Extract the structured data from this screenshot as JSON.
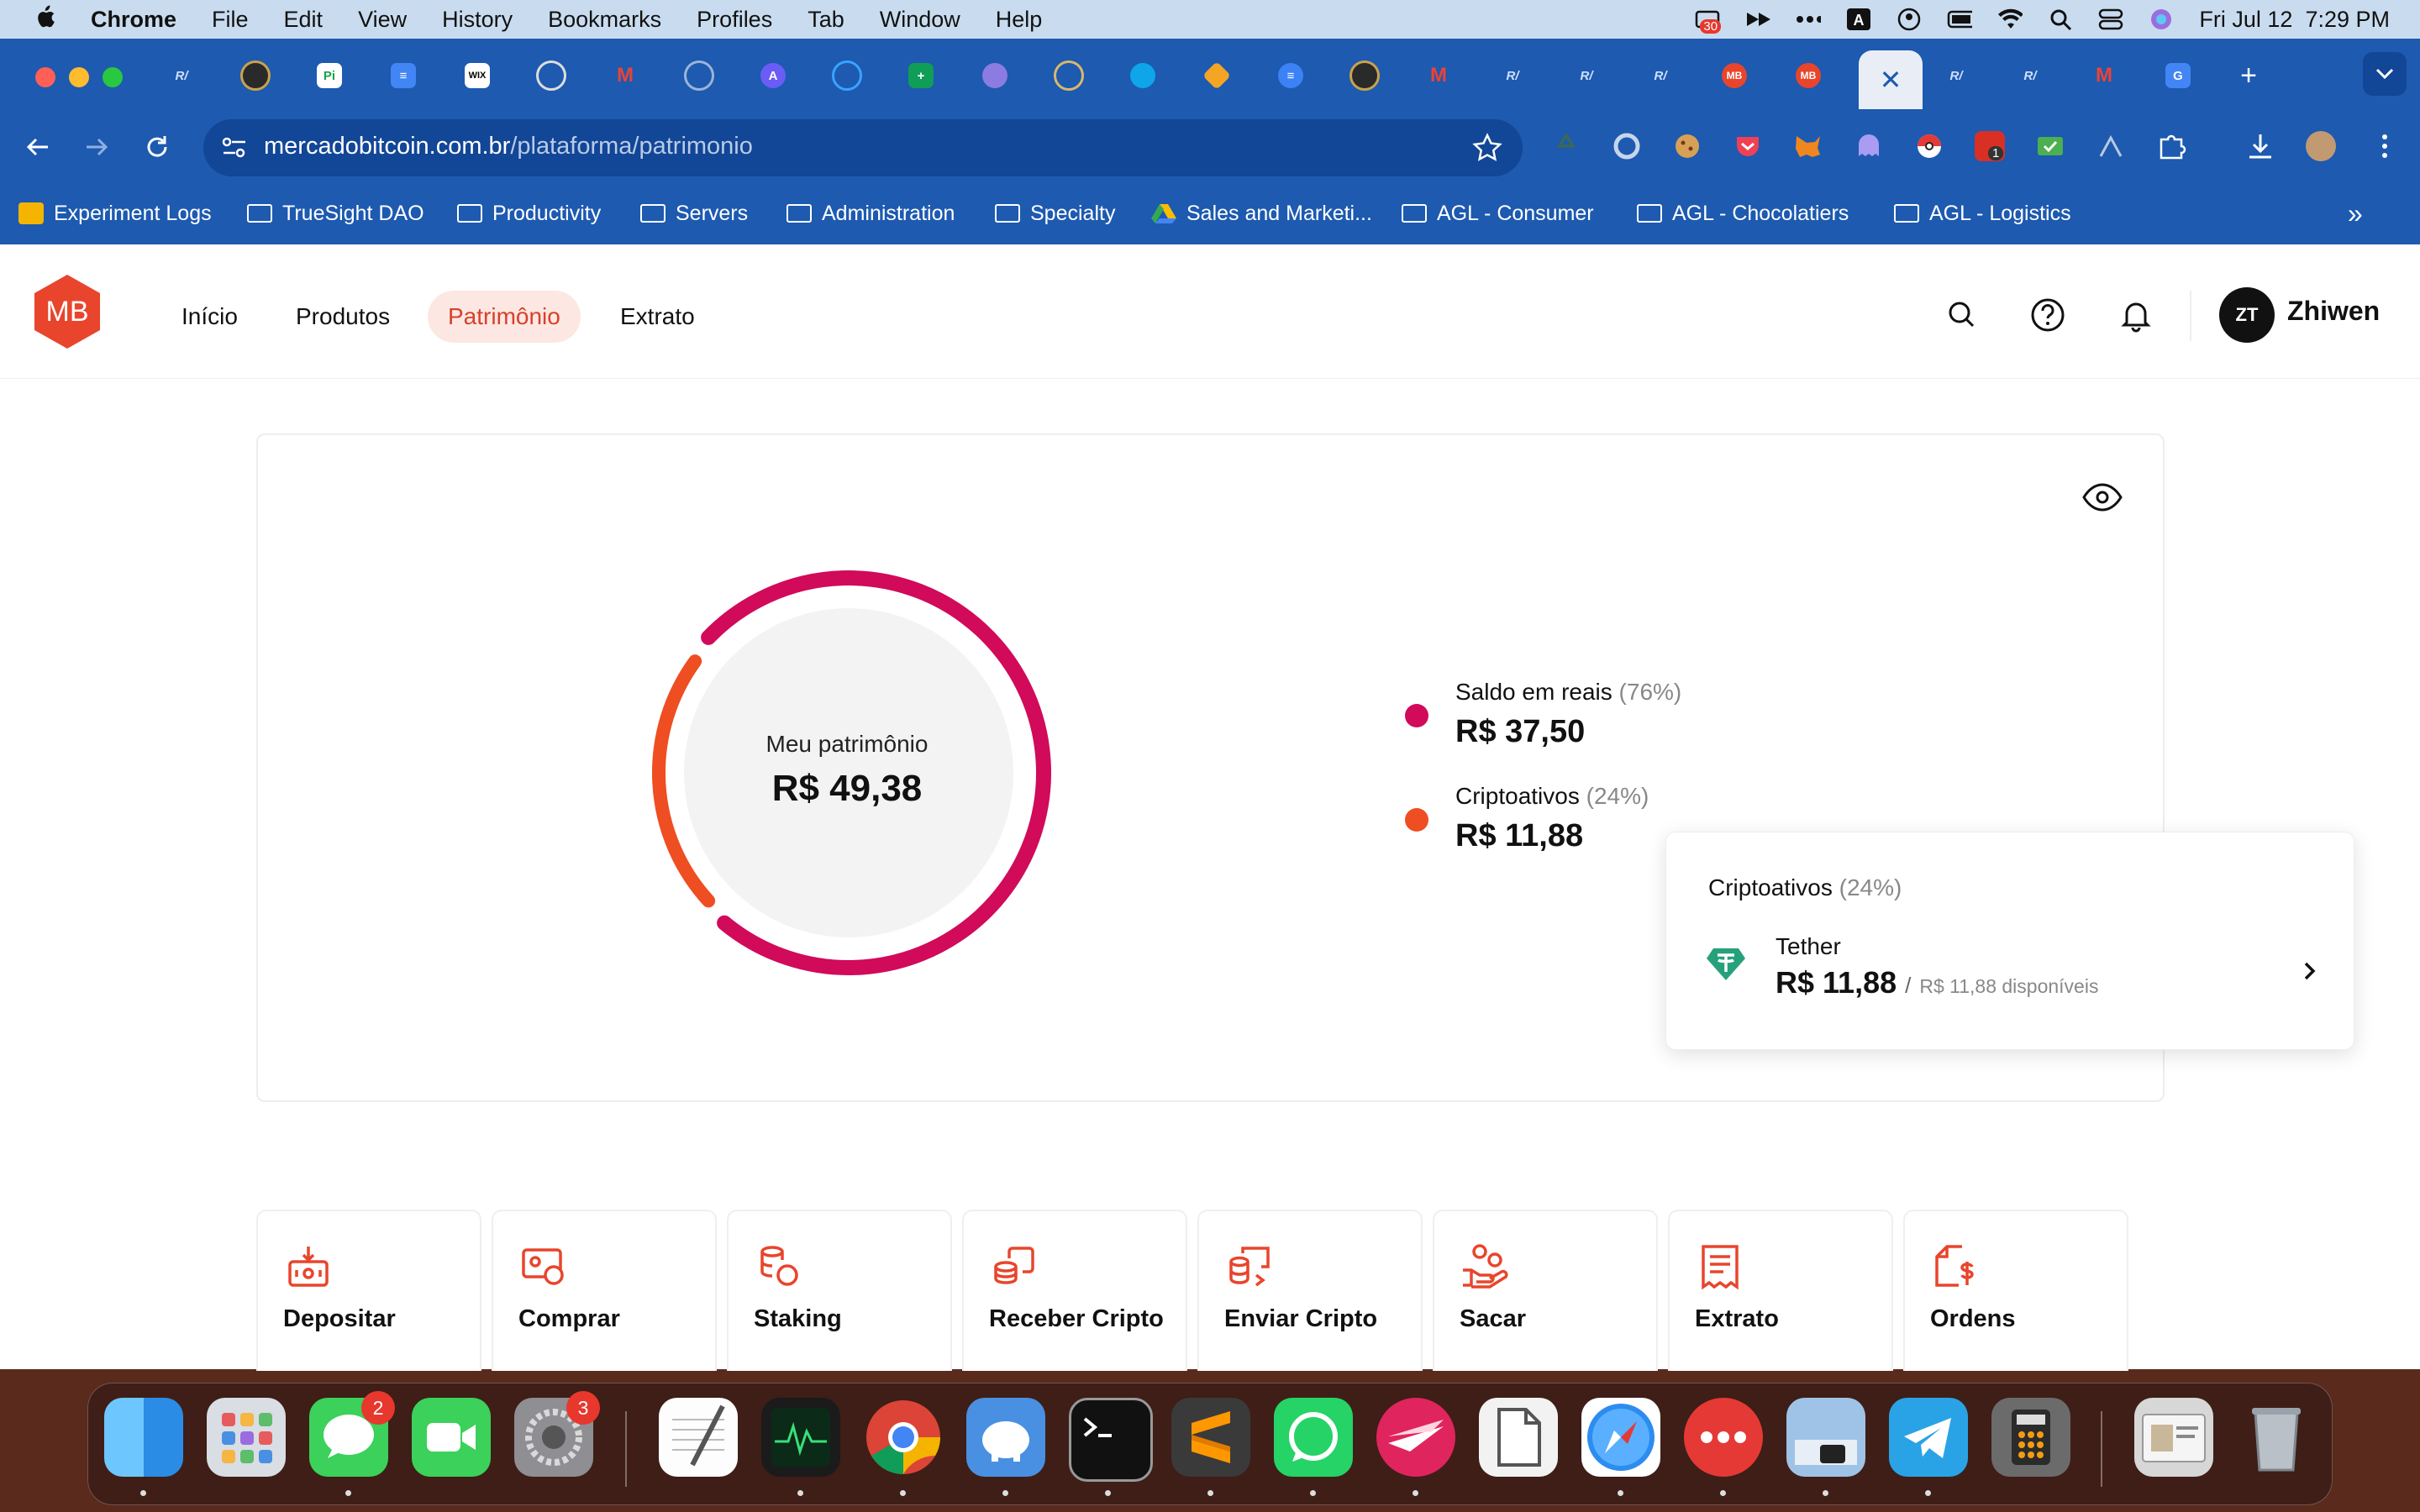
{
  "menubar": {
    "app": "Chrome",
    "items": [
      "File",
      "Edit",
      "View",
      "History",
      "Bookmarks",
      "Profiles",
      "Tab",
      "Window",
      "Help"
    ],
    "datetime": "Fri Jul 12  7:29 PM",
    "notification_count": "30"
  },
  "browser": {
    "url_host": "mercadobitcoin.com.br",
    "url_path": "/plataforma/patrimonio",
    "active_tab_close": "✕",
    "new_tab": "+",
    "bookmarks": [
      {
        "label": "Experiment Logs"
      },
      {
        "label": "TrueSight DAO"
      },
      {
        "label": "Productivity"
      },
      {
        "label": "Servers"
      },
      {
        "label": "Administration"
      },
      {
        "label": "Specialty"
      },
      {
        "label": "Sales and Marketi..."
      },
      {
        "label": "AGL - Consumer"
      },
      {
        "label": "AGL - Chocolatiers"
      },
      {
        "label": "AGL - Logistics"
      }
    ],
    "more_bookmarks": "»",
    "extension_badge": "1"
  },
  "app": {
    "logo": "MB",
    "nav": [
      {
        "label": "Início"
      },
      {
        "label": "Produtos"
      },
      {
        "label": "Patrimônio"
      },
      {
        "label": "Extrato"
      }
    ],
    "user_initials": "ZT",
    "user_name": "Zhiwen"
  },
  "portfolio": {
    "center_label": "Meu patrimônio",
    "total": "R$ 49,38",
    "legend": [
      {
        "label": "Saldo em reais",
        "pct": "(76%)",
        "value": "R$ 37,50",
        "color": "#d10a5a"
      },
      {
        "label": "Criptoativos",
        "pct": "(24%)",
        "value": "R$ 11,88",
        "color": "#ee4e22"
      }
    ],
    "popup": {
      "title": "Criptoativos",
      "pct": "(24%)",
      "asset_name": "Tether",
      "asset_value": "R$ 11,88",
      "separator": "/",
      "available": "R$ 11,88 disponíveis"
    }
  },
  "chart_data": {
    "type": "pie",
    "categories": [
      "Saldo em reais",
      "Criptoativos"
    ],
    "values": [
      76,
      24
    ],
    "colors": [
      "#d10a5a",
      "#ee4e22"
    ]
  },
  "actions": [
    {
      "label": "Depositar",
      "icon": "deposit-icon"
    },
    {
      "label": "Comprar",
      "icon": "buy-icon"
    },
    {
      "label": "Staking",
      "icon": "staking-icon"
    },
    {
      "label": "Receber Cripto",
      "icon": "receive-crypto-icon"
    },
    {
      "label": "Enviar Cripto",
      "icon": "send-crypto-icon"
    },
    {
      "label": "Sacar",
      "icon": "withdraw-icon"
    },
    {
      "label": "Extrato",
      "icon": "statement-icon"
    },
    {
      "label": "Ordens",
      "icon": "orders-icon"
    }
  ],
  "dock": {
    "messages_badge": "2",
    "settings_badge": "3"
  },
  "colors": {
    "brand": "#e8452c",
    "chrome_blue": "#1d5ab0",
    "accent_red": "#d10a5a",
    "accent_orange": "#ee4e22"
  }
}
